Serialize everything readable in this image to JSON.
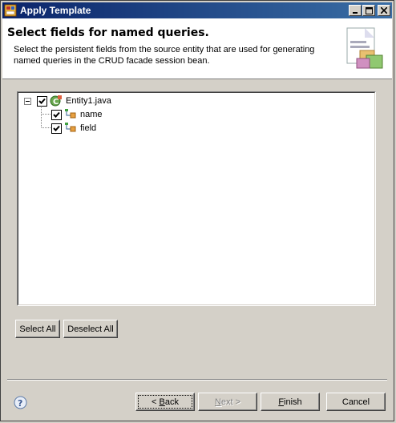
{
  "window": {
    "title": "Apply Template"
  },
  "header": {
    "title": "Select fields for named queries.",
    "description": "Select the persistent fields from the source entity that are used for generating named queries in the CRUD facade session bean."
  },
  "tree": {
    "root": {
      "label": "Entity1.java",
      "checked": true,
      "expanded": true,
      "icon": "java-entity-icon"
    },
    "children": [
      {
        "label": "name",
        "checked": true,
        "icon": "field-icon"
      },
      {
        "label": "field",
        "checked": true,
        "icon": "field-icon"
      }
    ]
  },
  "buttons": {
    "select_all": "Select All",
    "deselect_all": "Deselect All",
    "back_pre": "< ",
    "back_mn": "B",
    "back_post": "ack",
    "next_mn": "N",
    "next_post": "ext >",
    "finish_mn": "F",
    "finish_post": "inish",
    "cancel": "Cancel"
  },
  "colors": {
    "titlebar_start": "#0a246a",
    "titlebar_end": "#3a6ea5",
    "dialog_bg": "#d4d0c8"
  }
}
